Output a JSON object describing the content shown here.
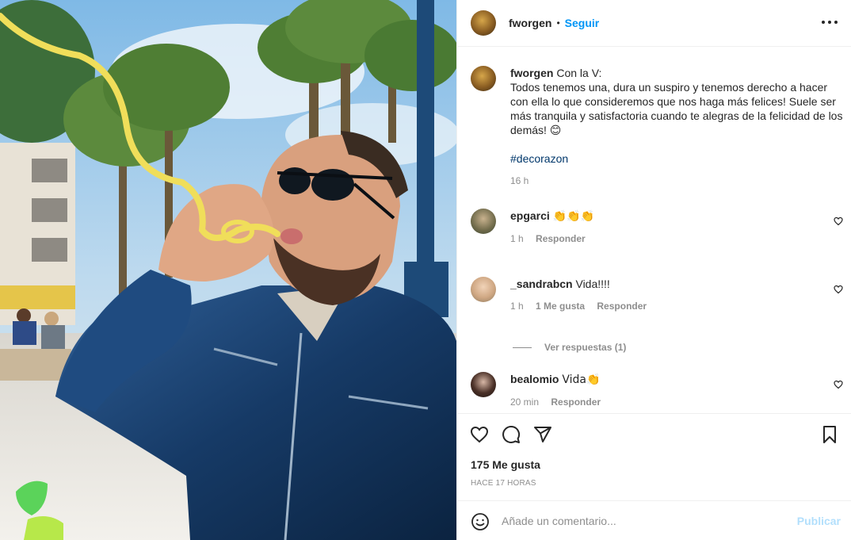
{
  "post": {
    "author": "fworgen",
    "follow_label": "Seguir",
    "separator": "•",
    "more_icon": "more-horizontal-icon"
  },
  "caption": {
    "author": "fworgen",
    "line1": "Con la V:",
    "text": "Todos tenemos una, dura un suspiro y tenemos derecho a hacer con ella lo que consideremos que nos haga más felices! Suele ser más tranquila y satisfactoria cuando te alegras de la felicidad de los demás! 😊",
    "hashtag": "#decorazon",
    "time": "16 h"
  },
  "comments": [
    {
      "user": "epgarci",
      "text": "👏👏👏",
      "time": "1 h",
      "likes": "",
      "reply": "Responder"
    },
    {
      "user": "_sandrabcn",
      "text": "Vida!!!!",
      "time": "1 h",
      "likes": "1 Me gusta",
      "reply": "Responder"
    },
    {
      "user": "bealomio",
      "text": "Vida👏",
      "time": "20 min",
      "likes": "",
      "reply": "Responder"
    }
  ],
  "view_replies": "Ver respuestas (1)",
  "actions": {
    "like_icon": "heart-icon",
    "comment_icon": "comment-icon",
    "share_icon": "send-icon",
    "save_icon": "bookmark-icon",
    "likes": "175 Me gusta",
    "timestamp": "HACE 17 HORAS"
  },
  "add_comment": {
    "placeholder": "Añade un comentario...",
    "publish": "Publicar",
    "emoji_icon": "smiley-icon"
  },
  "colors": {
    "accent": "#0095f6",
    "hashtag": "#00376b",
    "muted": "#8e8e8e",
    "publish_disabled": "#b2dffc"
  }
}
